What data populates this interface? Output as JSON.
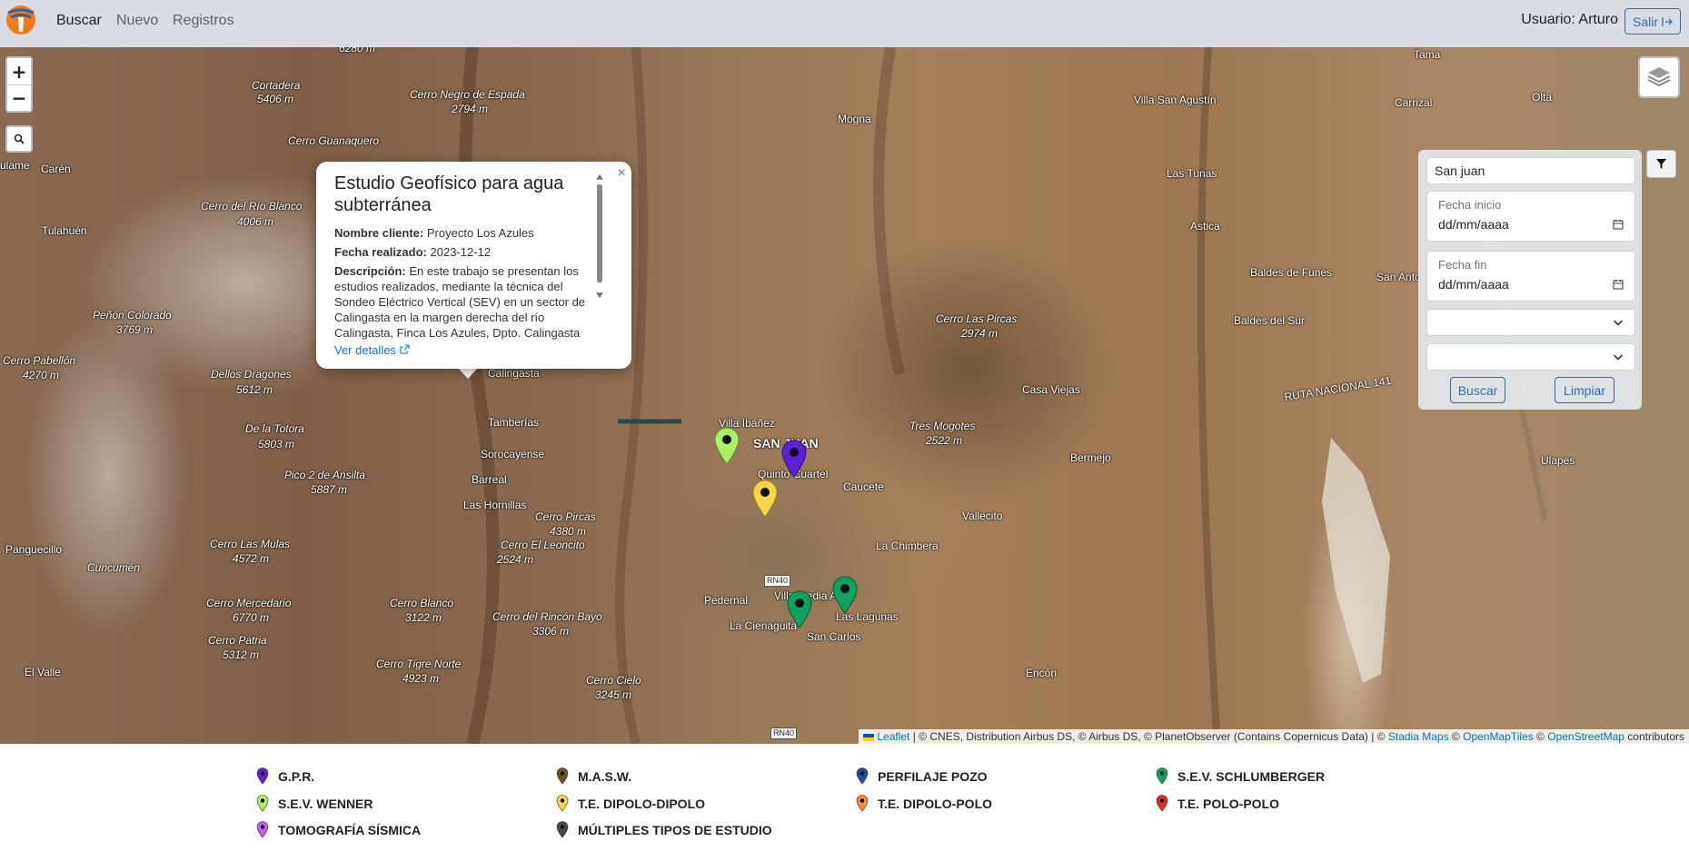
{
  "nav": {
    "links": [
      "Buscar",
      "Nuevo",
      "Registros"
    ],
    "user": "Usuario: Arturo",
    "logout": "Salir"
  },
  "map": {
    "zoom_in": "+",
    "zoom_out": "−",
    "labels": {
      "l1": "6280 m",
      "l2": "Cortadera",
      "l3": "5406 m",
      "l4": "Cerro Negro de Espada",
      "l5": "2794 m",
      "l6": "Mogna",
      "l7": "Villa San Agustín",
      "l8": "Tama",
      "l9": "Carrizal",
      "l10": "Olta",
      "l11": "ulame",
      "l12": "Carén",
      "l13": "Cerro Guanaquero",
      "l14": "Cerro del Río Blanco",
      "l15": "4006 m",
      "l16": "Tulahuén",
      "l17": "Las Tunas",
      "l18": "Astica",
      "l19": "Baldes de Funes",
      "l20": "San Anto",
      "l21": "Peñón Colorado",
      "l22": "3769 m",
      "l23": "Baldes del Sur",
      "l24": "Cerro Las Pircas",
      "l25": "2974 m",
      "l26": "Cerro Pabellón",
      "l27": "4270 m",
      "l28": "Dellos Dragones",
      "l29": "5612 m",
      "l30": "Calingasta",
      "l31": "Casa Viejas",
      "l32": "RUTA NACIONAL 141",
      "l33": "Tamberías",
      "l34": "De la Totora",
      "l35": "5803 m",
      "l36": "Villa Ibáñez",
      "l37": "Tres Mogotes",
      "l38": "2522 m",
      "l39": "Sorocayense",
      "l40": "SAN JUAN",
      "l41": "Quinto Cuartel",
      "l42": "Caucete",
      "l43": "Bermejo",
      "l44": "Ulapes",
      "l45": "Pico 2 de Ansilta",
      "l46": "5887 m",
      "l47": "Barreal",
      "l48": "Las Hornillas",
      "l49": "Cerro Pircas",
      "l50": "4380 m",
      "l51": "Vallecito",
      "l52": "Panguecillo",
      "l53": "Cerro Las Mulas",
      "l54": "4572 m",
      "l55": "Cerro El Leoncito",
      "l56": "2524 m",
      "l57": "La Chimbera",
      "l58": "Cuncumén",
      "l59": "Villa Media Agua",
      "l60": "Pedernal",
      "l61": "Cerro Mercedario",
      "l62": "6770 m",
      "l63": "Cerro Blanco",
      "l64": "3122 m",
      "l65": "Cerro del Rincón Bayo",
      "l66": "3306 m",
      "l67": "La Cienaguita",
      "l68": "Las Lagunas",
      "l69": "Cerro Patria",
      "l70": "5312 m",
      "l71": "San Carlos",
      "l72": "Cerro Tigre Norte",
      "l73": "4923 m",
      "l74": "El Valle",
      "l75": "Cerro Cielo",
      "l76": "3245 m",
      "l77": "Encón"
    },
    "roads": {
      "r1": "RN40",
      "r2": "RN40"
    },
    "attribution": {
      "leaflet": "Leaflet",
      "text1": "| © CNES, Distribution Airbus DS, © Airbus DS, © PlanetObserver (Contains Copernicus Data) | ©",
      "stadia": "Stadia Maps",
      "copy2": "©",
      "omt": "OpenMapTiles",
      "copy3": "©",
      "osm": "OpenStreetMap",
      "contrib": "contributors"
    }
  },
  "popup": {
    "close": "×",
    "title": "Estudio Geofísico para agua subterránea",
    "client_label": "Nombre cliente:",
    "client": "Proyecto Los Azules",
    "date_label": "Fecha realizado:",
    "date": "2023-12-12",
    "desc_label": "Descripción:",
    "desc": "En este trabajo se presentan los estudios realizados, mediante la técnica del Sondeo Eléctrico Vertical (SEV) en un sector de Calingasta en la margen derecha del río Calingasta, Finca Los Azules, Dpto. Calingasta",
    "link": "Ver detalles"
  },
  "filter": {
    "search_value": "San juan",
    "date_start_label": "Fecha inicio",
    "date_start_value": "dd/mm/aaaa",
    "date_end_label": "Fecha fin",
    "date_end_value": "dd/mm/aaaa",
    "select1": "",
    "select2": "",
    "search_btn": "Buscar",
    "clear_btn": "Limpiar"
  },
  "legend": [
    {
      "label": "G.P.R.",
      "color": "#5b21d6"
    },
    {
      "label": "M.A.S.W.",
      "color": "#6b5323"
    },
    {
      "label": "PERFILAJE POZO",
      "color": "#1d4f9e"
    },
    {
      "label": "S.E.V. SCHLUMBERGER",
      "color": "#10a060"
    },
    {
      "label": "S.E.V. WENNER",
      "color": "#a8f064"
    },
    {
      "label": "T.E. DIPOLO-DIPOLO",
      "color": "#f7d548"
    },
    {
      "label": "T.E. DIPOLO-POLO",
      "color": "#f58a3c"
    },
    {
      "label": "T.E. POLO-POLO",
      "color": "#e62a2a"
    },
    {
      "label": "TOMOGRAFÍA SÍSMICA",
      "color": "#c060e8"
    },
    {
      "label": "MÚLTIPLES TIPOS DE ESTUDIO",
      "color": "#4a4a4a"
    }
  ],
  "colors": {
    "navbar_bg": "#d9dde3",
    "accent": "#2e6fb0",
    "link": "#0d6efd",
    "marker_green": "#10a060",
    "marker_lime": "#a8f064",
    "marker_purple": "#5b21d6",
    "marker_yellow": "#f7d548"
  }
}
